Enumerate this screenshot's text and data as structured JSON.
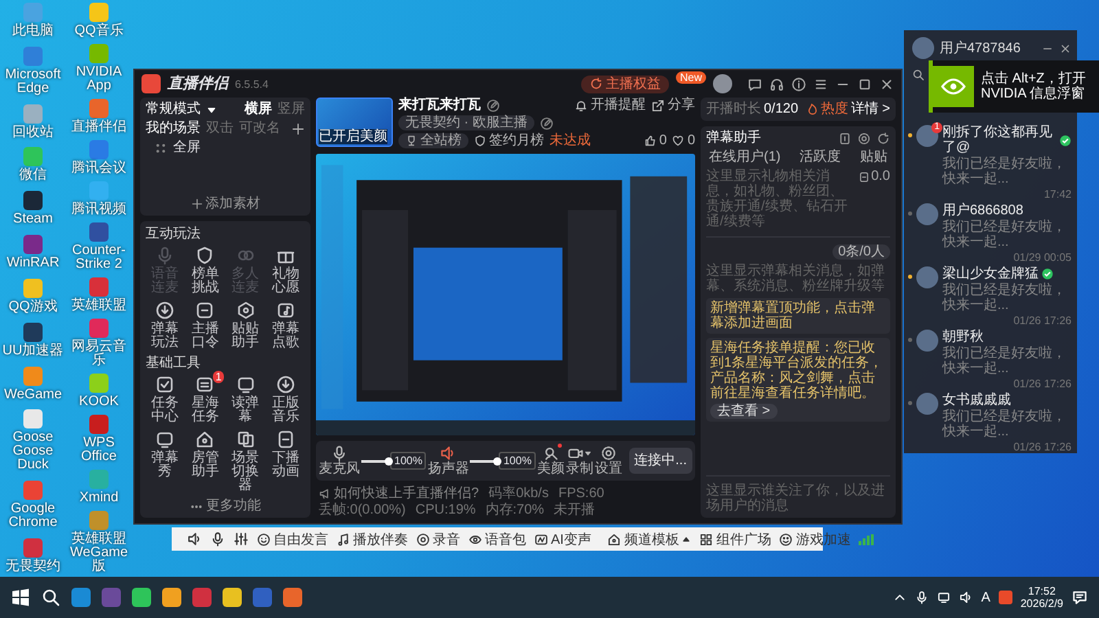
{
  "desktop": {
    "columns": [
      {
        "icons": [
          {
            "label": "此电脑"
          },
          {
            "label": "Microsoft Edge"
          },
          {
            "label": "回收站"
          },
          {
            "label": "微信"
          },
          {
            "label": "Steam"
          },
          {
            "label": "WinRAR"
          },
          {
            "label": "QQ游戏"
          },
          {
            "label": "UU加速器"
          },
          {
            "label": "WeGame"
          },
          {
            "label": "Goose Goose Duck"
          },
          {
            "label": "Google Chrome"
          },
          {
            "label": "无畏契约"
          }
        ]
      },
      {
        "icons": [
          {
            "label": "QQ音乐"
          },
          {
            "label": "NVIDIA App"
          },
          {
            "label": "直播伴侣"
          },
          {
            "label": "腾讯会议"
          },
          {
            "label": "腾讯视频"
          },
          {
            "label": "Counter-Strike 2"
          },
          {
            "label": "英雄联盟"
          },
          {
            "label": "网易云音乐"
          },
          {
            "label": "KOOK"
          },
          {
            "label": "WPS Office"
          },
          {
            "label": "Xmind"
          },
          {
            "label": "英雄联盟WeGame版"
          }
        ]
      }
    ]
  },
  "app": {
    "name": "直播伴侣",
    "version": "6.5.5.4",
    "perks_button": "主播权益",
    "perks_badge": "New",
    "scenes": {
      "mode": "常规模式",
      "orientations": [
        {
          "label": "横屏",
          "selected": true
        },
        {
          "label": "竖屏",
          "selected": false
        }
      ],
      "title": "我的场景",
      "hints": [
        "双击",
        "可改名"
      ],
      "items": [
        {
          "label": "全屏"
        }
      ],
      "add_button": "添加素材"
    },
    "interactive": {
      "title": "互动玩法",
      "tools": [
        {
          "label": "语音连麦",
          "disabled": true
        },
        {
          "label": "榜单挑战",
          "disabled": false
        },
        {
          "label": "多人连麦",
          "disabled": true
        },
        {
          "label": "礼物心愿",
          "disabled": false
        },
        {
          "label": "弹幕玩法",
          "disabled": false
        },
        {
          "label": "主播口令",
          "disabled": false
        },
        {
          "label": "贴贴助手",
          "disabled": false
        },
        {
          "label": "弹幕点歌",
          "disabled": false
        }
      ]
    },
    "basic": {
      "title": "基础工具",
      "tools": [
        {
          "label": "任务中心",
          "disabled": false
        },
        {
          "label": "星海任务",
          "disabled": false,
          "badge": "1"
        },
        {
          "label": "读弹幕",
          "disabled": false
        },
        {
          "label": "正版音乐",
          "disabled": false
        },
        {
          "label": "弹幕秀",
          "disabled": false
        },
        {
          "label": "房管助手",
          "disabled": false
        },
        {
          "label": "场景切换器",
          "disabled": false
        },
        {
          "label": "下播动画",
          "disabled": false
        }
      ]
    },
    "more_button": "更多功能",
    "stream": {
      "thumbnail_caption": "已开启美颜",
      "title": "来打瓦来打瓦",
      "reminder": "开播提醒",
      "share": "分享",
      "tag": "无畏契约 · 欧服主播",
      "rank": "全站榜",
      "monthly": "签约月榜",
      "monthly_status": "未达成",
      "likes": "0",
      "hearts": "0"
    },
    "audio": [
      {
        "kind": "mic",
        "label": "麦克风",
        "level": 1,
        "reading": "100%"
      },
      {
        "kind": "speaker",
        "label": "扬声器",
        "level": 1,
        "reading": "100%"
      }
    ],
    "actions": [
      {
        "kind": "beauty",
        "label": "美颜"
      },
      {
        "kind": "record",
        "label": "录制"
      },
      {
        "kind": "settings",
        "label": "设置"
      }
    ],
    "connect_button": "连接中...",
    "status": {
      "tip": "如何快速上手直播伴侣?",
      "stats": [
        "码率0kb/s",
        "FPS:60",
        "丢帧:0(0.00%)",
        "CPU:19%",
        "内存:70%",
        "未开播"
      ]
    },
    "live": {
      "duration_label": "开播时长",
      "duration": "0/120",
      "heat": "热度",
      "details": "详情 >"
    },
    "assistant": {
      "title": "弹幕助手",
      "tabs": [
        {
          "label": "在线用户(1)"
        },
        {
          "label": "活跃度"
        },
        {
          "label": "贴贴"
        }
      ],
      "gift_hint": "这里显示礼物相关消息，如礼物、粉丝团、贵族开通/续费、钻石开通/续费等",
      "gift_value": "0.0",
      "danmaku_count": "0条/0人",
      "danmaku_hint": "这里显示弹幕相关消息，如弹幕、系统消息、粉丝牌升级等",
      "notices": [
        {
          "text": "新增弹幕置顶功能，点击弹幕添加进画面"
        },
        {
          "text": "星海任务接单提醒：您已收到1条星海平台派发的任务，产品名称：风之剑舞，点击前往星海查看任务详情吧。",
          "action": "去查看 >"
        }
      ],
      "follow_hint": "这里显示谁关注了你，以及进场用户的消息"
    }
  },
  "voice_toolbar": {
    "tools": [
      {
        "kind": "speaker"
      },
      {
        "kind": "mic"
      },
      {
        "kind": "mixer"
      },
      {
        "kind": "talk",
        "label": "自由发言"
      },
      {
        "kind": "music",
        "label": "播放伴奏"
      },
      {
        "kind": "record",
        "label": "录音"
      },
      {
        "kind": "pack",
        "label": "语音包"
      },
      {
        "kind": "ai",
        "label": "AI变声"
      }
    ],
    "right": [
      {
        "kind": "template",
        "label": "频道模板"
      },
      {
        "kind": "plaza",
        "label": "组件广场"
      },
      {
        "kind": "boost",
        "label": "游戏加速"
      }
    ]
  },
  "chat_panel": {
    "user": "用户4787846",
    "chats": [
      {
        "name": "刚拆了你这都再见了@",
        "preview": "我们已经是好友啦，快来一起...",
        "time": "17:42",
        "unread": true,
        "verified": true,
        "badge": "1"
      },
      {
        "name": "用户6866808",
        "preview": "我们已经是好友啦，快来一起...",
        "time": "01/29 00:05",
        "unread": false,
        "verified": false
      },
      {
        "name": "梁山少女金牌猛",
        "preview": "我们已经是好友啦，快来一起...",
        "time": "01/26 17:26",
        "unread": true,
        "verified": true
      },
      {
        "name": "朝野秋",
        "preview": "我们已经是好友啦，快来一起...",
        "time": "01/26 17:26",
        "unread": false,
        "verified": false
      },
      {
        "name": "女书戚戚戚",
        "preview": "我们已经是好友啦，快来一起...",
        "time": "01/26 17:26",
        "unread": false,
        "verified": false
      }
    ]
  },
  "toast": {
    "text": "点击 Alt+Z，打开 NVIDIA 信息浮窗"
  },
  "taskbar": {
    "input_indicator": "A",
    "time": "17:52",
    "date": "2026/2/9"
  }
}
